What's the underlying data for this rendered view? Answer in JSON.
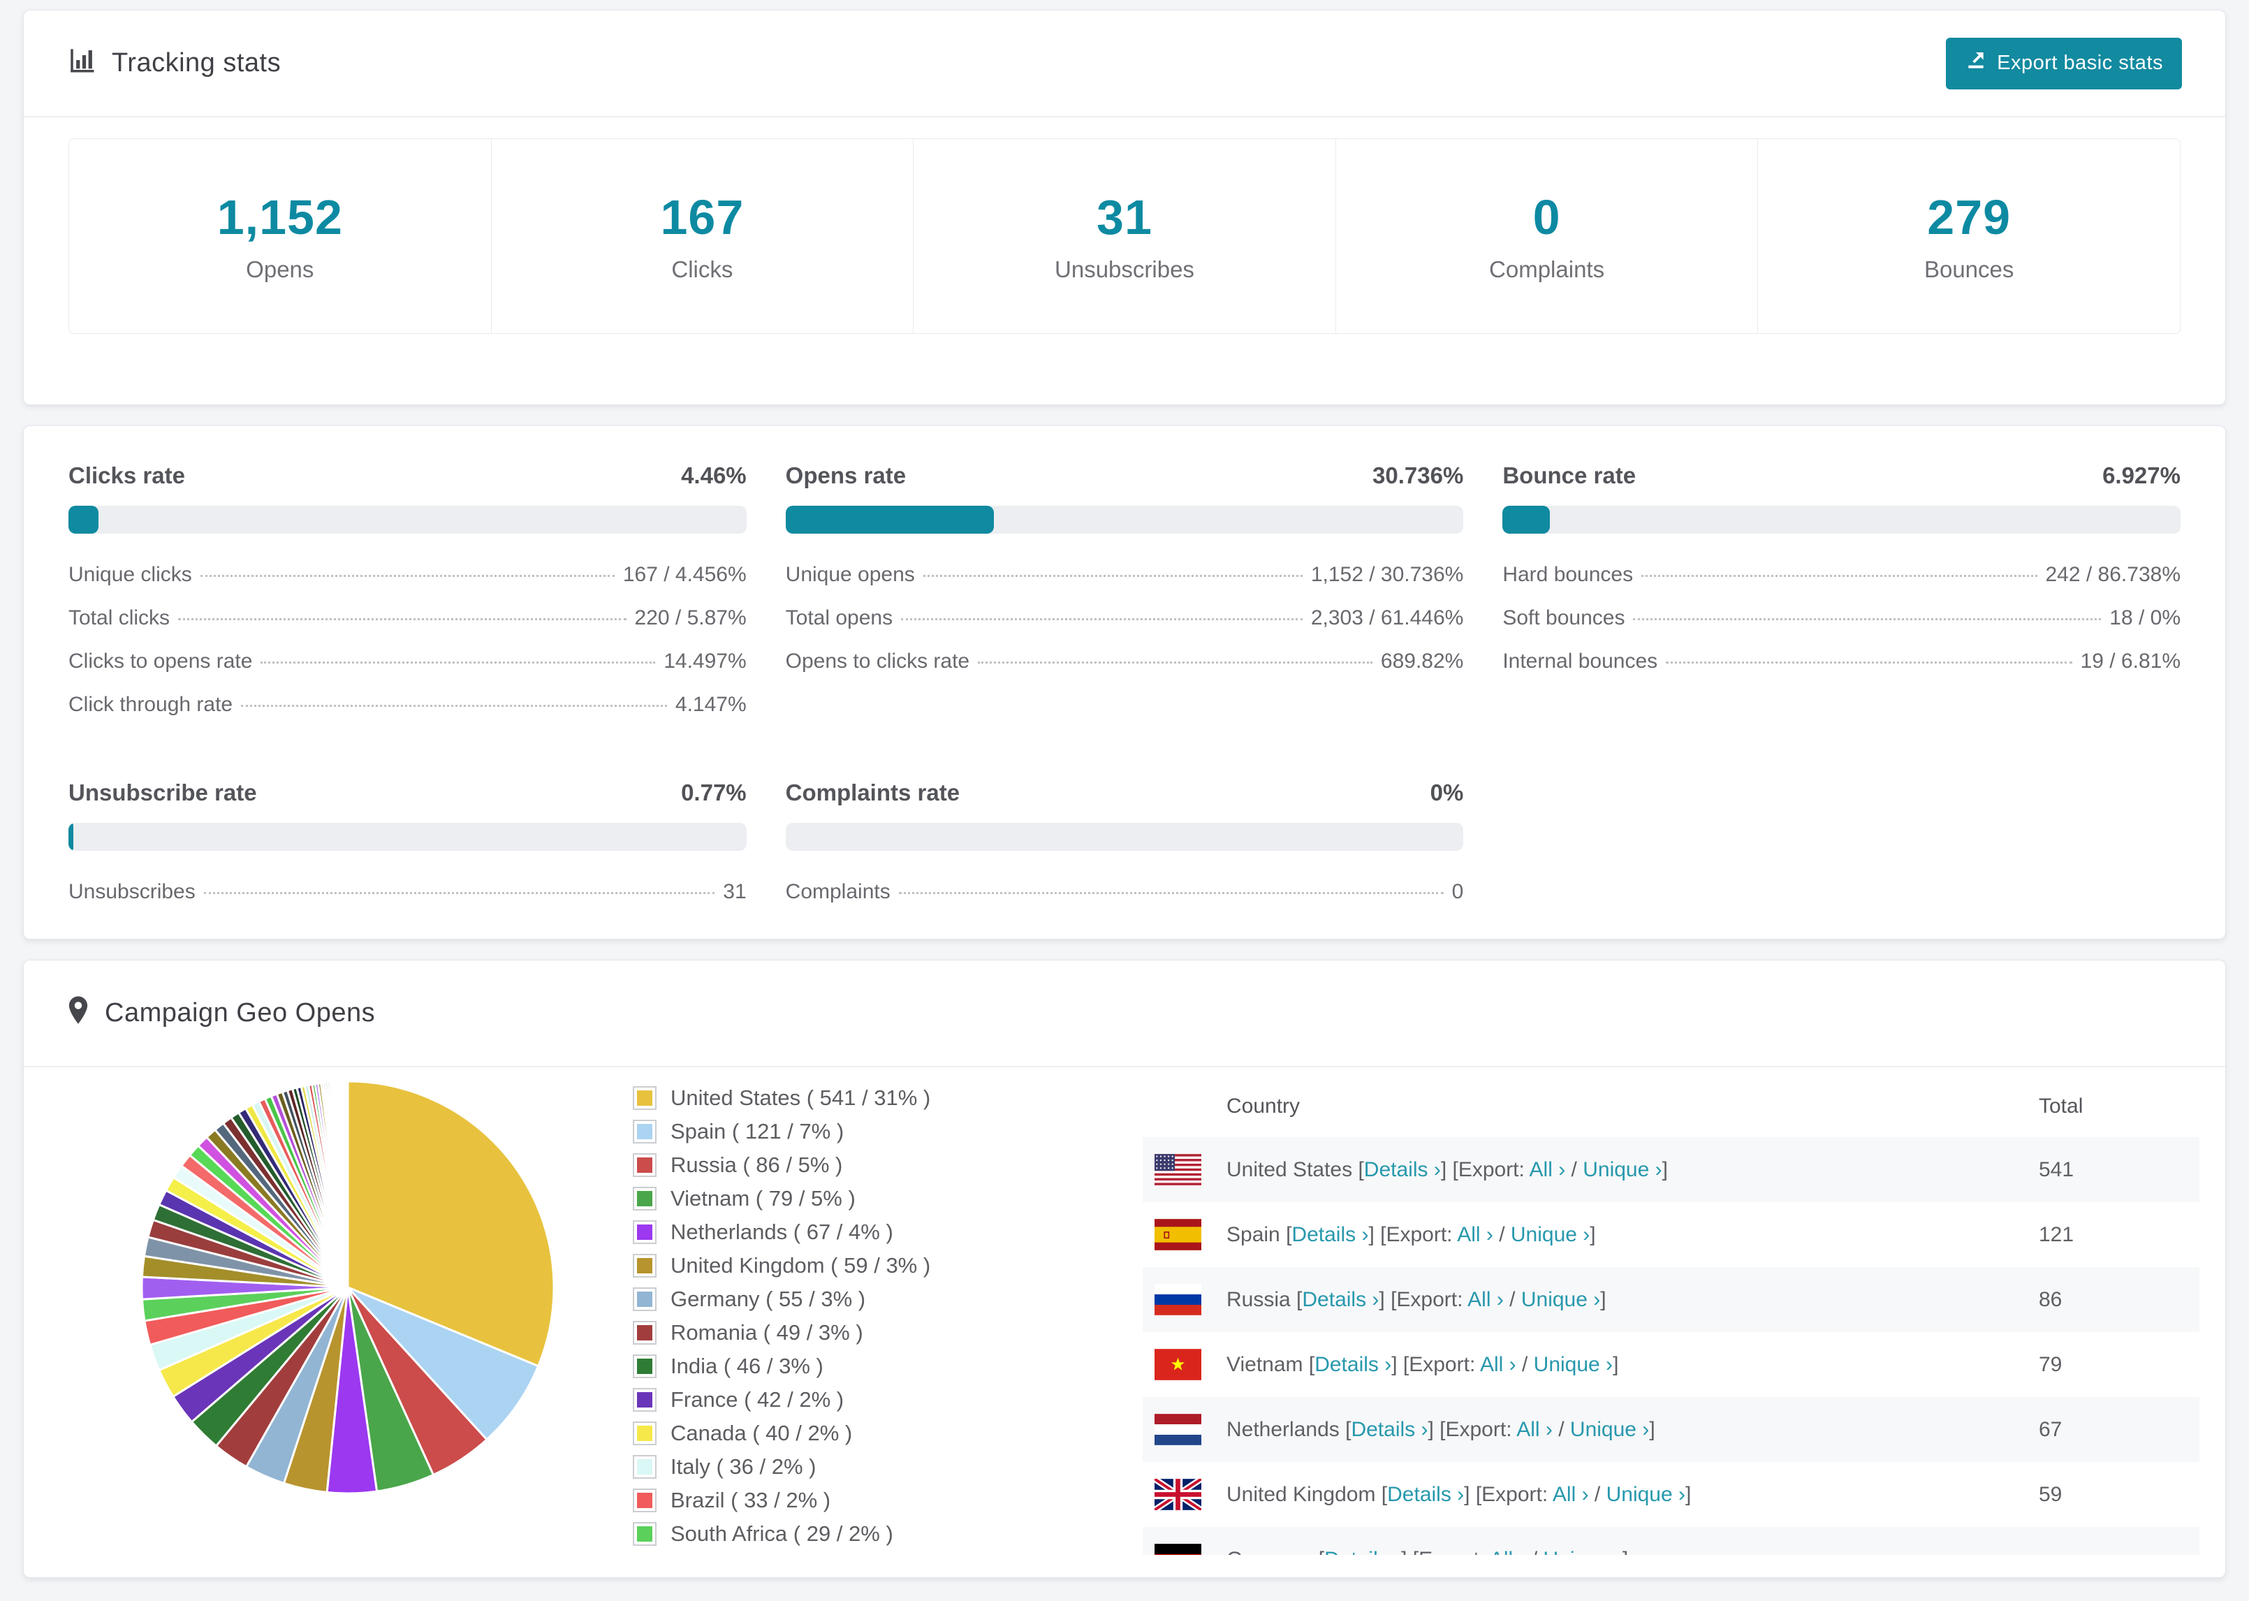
{
  "colors": {
    "accent_teal": "#128aa0",
    "number_teal": "#0d8aa2",
    "link_teal": "#2798ad",
    "bar_track": "#eceef1",
    "row_alt_bg": "#f7f8f9",
    "page_bg": "#f4f5f7"
  },
  "tracking": {
    "title": "Tracking stats",
    "export_button": "Export basic stats",
    "stats": [
      {
        "value": "1,152",
        "label": "Opens"
      },
      {
        "value": "167",
        "label": "Clicks"
      },
      {
        "value": "31",
        "label": "Unsubscribes"
      },
      {
        "value": "0",
        "label": "Complaints"
      },
      {
        "value": "279",
        "label": "Bounces"
      }
    ]
  },
  "rates": {
    "groups": [
      {
        "title": "Clicks rate",
        "value": "4.46%",
        "percent": 4.46,
        "rows": [
          {
            "label": "Unique clicks",
            "value": "167 / 4.456%"
          },
          {
            "label": "Total clicks",
            "value": "220 / 5.87%"
          },
          {
            "label": "Clicks to opens rate",
            "value": "14.497%"
          },
          {
            "label": "Click through rate",
            "value": "4.147%"
          }
        ]
      },
      {
        "title": "Opens rate",
        "value": "30.736%",
        "percent": 30.736,
        "rows": [
          {
            "label": "Unique opens",
            "value": "1,152 / 30.736%"
          },
          {
            "label": "Total opens",
            "value": "2,303 / 61.446%"
          },
          {
            "label": "Opens to clicks rate",
            "value": "689.82%"
          }
        ]
      },
      {
        "title": "Bounce rate",
        "value": "6.927%",
        "percent": 6.927,
        "rows": [
          {
            "label": "Hard bounces",
            "value": "242 / 86.738%"
          },
          {
            "label": "Soft bounces",
            "value": "18 / 0%"
          },
          {
            "label": "Internal bounces",
            "value": "19 / 6.81%"
          }
        ]
      },
      {
        "title": "Unsubscribe rate",
        "value": "0.77%",
        "percent": 0.77,
        "rows": [
          {
            "label": "Unsubscribes",
            "value": "31"
          }
        ]
      },
      {
        "title": "Complaints rate",
        "value": "0%",
        "percent": 0,
        "rows": [
          {
            "label": "Complaints",
            "value": "0"
          }
        ]
      }
    ]
  },
  "geo": {
    "title": "Campaign Geo Opens",
    "legend_format": {
      "pre": " ( ",
      "mid": " / ",
      "post": " )"
    },
    "table": {
      "headers": {
        "country": "Country",
        "total": "Total"
      },
      "tokens": {
        "lb": "[",
        "rb": "]",
        "details": "Details ›",
        "export_label": "Export:",
        "all": "All ›",
        "sep": "/",
        "unique": "Unique ›"
      },
      "rows": [
        {
          "country": "United States",
          "total": "541",
          "flag": "us"
        },
        {
          "country": "Spain",
          "total": "121",
          "flag": "es"
        },
        {
          "country": "Russia",
          "total": "86",
          "flag": "ru"
        },
        {
          "country": "Vietnam",
          "total": "79",
          "flag": "vn"
        },
        {
          "country": "Netherlands",
          "total": "67",
          "flag": "nl"
        },
        {
          "country": "United Kingdom",
          "total": "59",
          "flag": "gb"
        },
        {
          "country": "Germany",
          "total": "",
          "flag": "de",
          "partial": true
        }
      ]
    }
  },
  "chart_data": {
    "type": "pie",
    "title": "Campaign Geo Opens",
    "legend_position": "right-of-chart",
    "start_angle_deg": 0,
    "direction": "clockwise",
    "series": [
      {
        "name": "United States",
        "value": 541,
        "pct": "31%",
        "color": "#e8c23e"
      },
      {
        "name": "Spain",
        "value": 121,
        "pct": "7%",
        "color": "#abd3f2"
      },
      {
        "name": "Russia",
        "value": 86,
        "pct": "5%",
        "color": "#cc4b4b"
      },
      {
        "name": "Vietnam",
        "value": 79,
        "pct": "5%",
        "color": "#4aa64a"
      },
      {
        "name": "Netherlands",
        "value": 67,
        "pct": "4%",
        "color": "#9b38f0"
      },
      {
        "name": "United Kingdom",
        "value": 59,
        "pct": "3%",
        "color": "#b8942e"
      },
      {
        "name": "Germany",
        "value": 55,
        "pct": "3%",
        "color": "#91b5d3"
      },
      {
        "name": "Romania",
        "value": 49,
        "pct": "3%",
        "color": "#a23d3d"
      },
      {
        "name": "India",
        "value": 46,
        "pct": "3%",
        "color": "#2f7c34"
      },
      {
        "name": "France",
        "value": 42,
        "pct": "2%",
        "color": "#6a35b8"
      },
      {
        "name": "Canada",
        "value": 40,
        "pct": "2%",
        "color": "#f6e84a"
      },
      {
        "name": "Italy",
        "value": 36,
        "pct": "2%",
        "color": "#d9f8f6"
      },
      {
        "name": "Brazil",
        "value": 33,
        "pct": "2%",
        "color": "#f15b5b"
      },
      {
        "name": "South Africa",
        "value": 29,
        "pct": "2%",
        "color": "#5bd05b"
      }
    ],
    "other_slices": {
      "note": "unlabeled long-tail slices visible in pie",
      "values": [
        30,
        28,
        26,
        24,
        22,
        21,
        20,
        19,
        18,
        17,
        16,
        15,
        14,
        13,
        12,
        11,
        10,
        10,
        9,
        9,
        8,
        8,
        7,
        7,
        6,
        6,
        5,
        5,
        5,
        4,
        4,
        4,
        3,
        3,
        3,
        3,
        2,
        2,
        2,
        2,
        2,
        2,
        1,
        1,
        1,
        1,
        1,
        1,
        1,
        1,
        1,
        1,
        1,
        1
      ],
      "colors": [
        "#a15ff0",
        "#a38e2a",
        "#7f93a8",
        "#9a3d3d",
        "#2e6f35",
        "#5a35b0",
        "#f5ef49",
        "#e8fbfa",
        "#f46a6a",
        "#57d957",
        "#cf52e0",
        "#8a7a22",
        "#53687d",
        "#7c3030",
        "#245c2b",
        "#332a77",
        "#efe742",
        "#d9f6f4",
        "#e85c5c",
        "#49c649",
        "#b44fd9",
        "#6b5f1d",
        "#43525f",
        "#5e2525",
        "#1c4a22",
        "#2a2363",
        "#e0d83c",
        "#c2ebe8",
        "#d94f4f",
        "#3cb33c"
      ]
    }
  }
}
